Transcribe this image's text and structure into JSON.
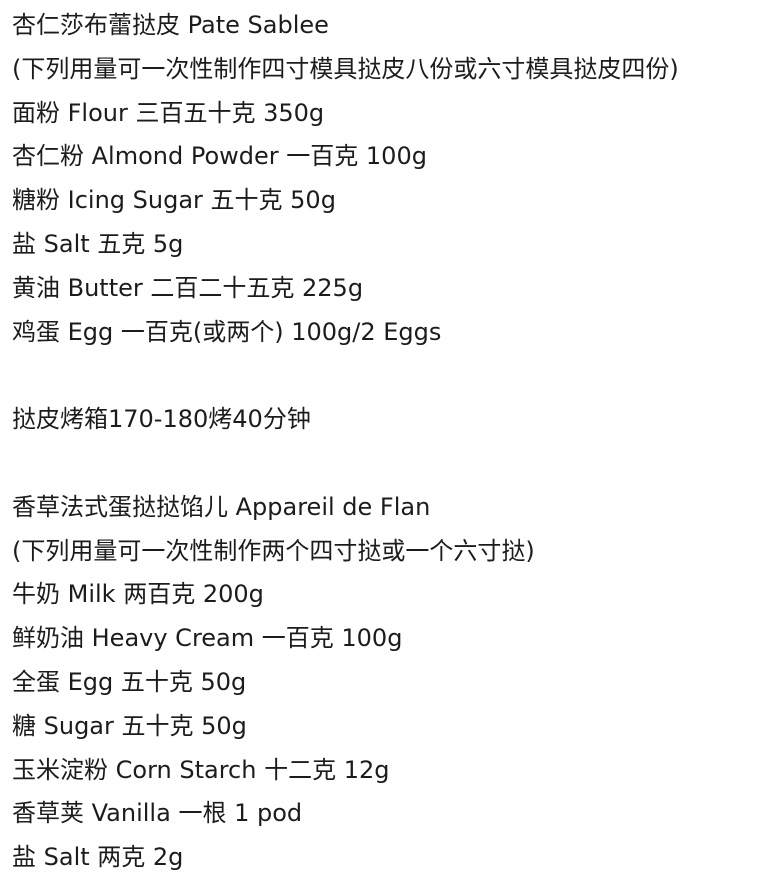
{
  "recipe": {
    "sections": [
      {
        "title": "杏仁莎布蕾挞皮 Pate Sablee",
        "note": "(下列用量可一次性制作四寸模具挞皮八份或六寸模具挞皮四份)",
        "ingredients": [
          "面粉 Flour 三百五十克 350g",
          "杏仁粉 Almond Powder 一百克 100g",
          "糖粉 Icing Sugar 五十克 50g",
          "盐 Salt 五克 5g",
          "黄油 Butter 二百二十五克 225g",
          "鸡蛋 Egg 一百克(或两个) 100g/2 Eggs"
        ]
      },
      {
        "instruction": "挞皮烤箱170-180烤40分钟"
      },
      {
        "title": "香草法式蛋挞挞馅儿 Appareil de Flan",
        "note": "(下列用量可一次性制作两个四寸挞或一个六寸挞)",
        "ingredients": [
          "牛奶 Milk 两百克 200g",
          "鲜奶油 Heavy Cream 一百克 100g",
          "全蛋 Egg 五十克 50g",
          "糖 Sugar 五十克 50g",
          "玉米淀粉 Corn Starch 十二克 12g",
          "香草荚 Vanilla 一根 1 pod",
          "盐 Salt 两克 2g"
        ]
      }
    ]
  }
}
